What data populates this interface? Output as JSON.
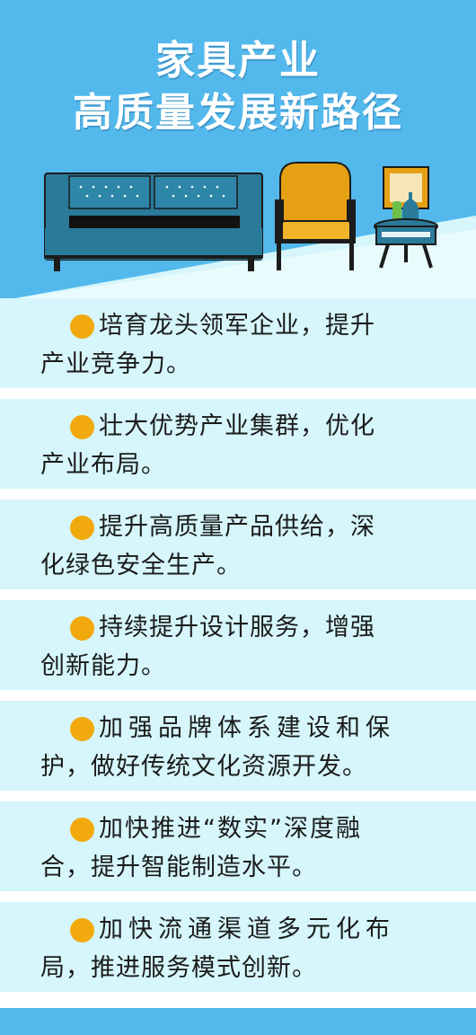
{
  "header": {
    "title_line1": "家具产业",
    "title_line2": "高质量发展新路径",
    "colors": {
      "sky": "#53b9ec",
      "sofa": "#2a7a9a",
      "chair": "#e6a014",
      "ink": "#1a1a1a"
    }
  },
  "items": [
    {
      "line1": "培育龙头领军企业，提升",
      "line2": "产业竞争力。"
    },
    {
      "line1": "壮大优势产业集群，优化",
      "line2": "产业布局。"
    },
    {
      "line1": "提升高质量产品供给，深",
      "line2": "化绿色安全生产。"
    },
    {
      "line1": "持续提升设计服务，增强",
      "line2": "创新能力。"
    },
    {
      "line1": "加强品牌体系建设和保",
      "line2": "护，做好传统文化资源开发。"
    },
    {
      "line1": "加快推进“数实”深度融",
      "line2": "合，提升智能制造水平。"
    },
    {
      "line1": "加快流通渠道多元化布",
      "line2": "局，推进服务模式创新。"
    }
  ]
}
